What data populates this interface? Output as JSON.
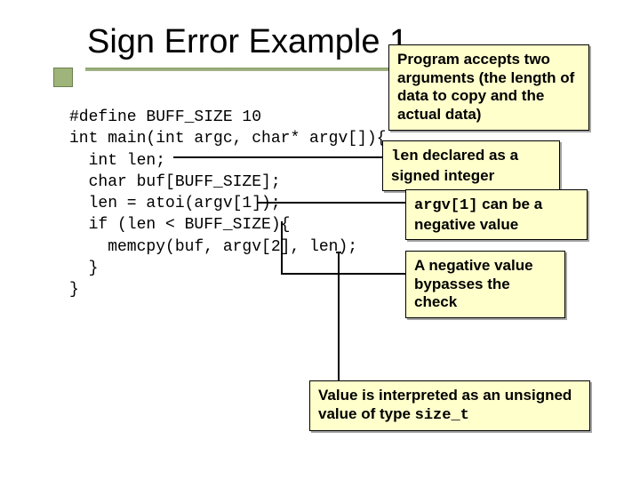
{
  "title": "Sign Error Example 1",
  "code": {
    "l0": "#define BUFF_SIZE 10",
    "l1": "int main(int argc, char* argv[]){",
    "l2": "  int len;",
    "l3": "  char buf[BUFF_SIZE];",
    "l4": "  len = atoi(argv[1]);",
    "l5": "  if (len < BUFF_SIZE){",
    "l6": "    memcpy(buf, argv[2], len);",
    "l7": "  }",
    "l8": "}"
  },
  "callouts": {
    "c1": "Program accepts two arguments (the length of data to copy and the actual data)",
    "c2a": "len",
    "c2b": " declared as a signed integer",
    "c3a": "argv[1]",
    "c3b": " can be a negative value",
    "c4": "A negative value bypasses the check",
    "c5a": "Value is interpreted as an unsigned value of type ",
    "c5b": "size_t"
  }
}
